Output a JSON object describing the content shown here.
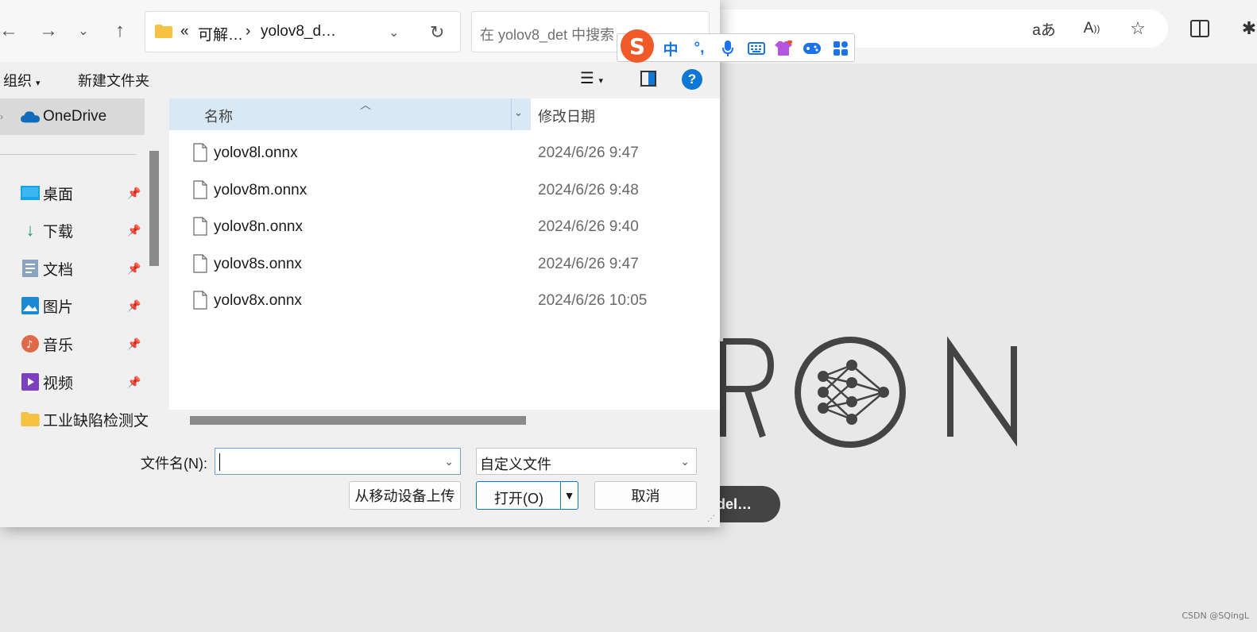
{
  "browser": {
    "open_model_label": "del…",
    "toolbar_icons": [
      "translate-icon",
      "read-aloud-icon",
      "favorite-star-icon",
      "split-screen-icon",
      "extensions-icon"
    ]
  },
  "watermark": "CSDN @SQingL",
  "dialog": {
    "breadcrumb": {
      "overflow": "«",
      "segment1": "可解…",
      "separator": "›",
      "segment2": "yolov8_d…"
    },
    "search_placeholder": "在 yolov8_det 中搜索",
    "toolbar": {
      "organize": "组织",
      "new_folder": "新建文件夹",
      "help": "?"
    },
    "sidebar": {
      "onedrive": "OneDrive",
      "items": [
        {
          "label": "桌面",
          "icon": "desktop-icon"
        },
        {
          "label": "下载",
          "icon": "download-icon"
        },
        {
          "label": "文档",
          "icon": "documents-icon"
        },
        {
          "label": "图片",
          "icon": "pictures-icon"
        },
        {
          "label": "音乐",
          "icon": "music-icon"
        },
        {
          "label": "视频",
          "icon": "videos-icon"
        },
        {
          "label": "工业缺陷检测文",
          "icon": "folder-icon"
        }
      ]
    },
    "columns": {
      "name": "名称",
      "date": "修改日期"
    },
    "files": [
      {
        "name": "yolov8l.onnx",
        "date": "2024/6/26 9:47"
      },
      {
        "name": "yolov8m.onnx",
        "date": "2024/6/26 9:48"
      },
      {
        "name": "yolov8n.onnx",
        "date": "2024/6/26 9:40"
      },
      {
        "name": "yolov8s.onnx",
        "date": "2024/6/26 9:47"
      },
      {
        "name": "yolov8x.onnx",
        "date": "2024/6/26 10:05"
      }
    ],
    "filename_label": "文件名(N):",
    "filename_value": "",
    "filter_value": "自定义文件",
    "buttons": {
      "upload": "从移动设备上传",
      "open": "打开(O)",
      "cancel": "取消"
    }
  },
  "ime": {
    "logo": "S",
    "mode": "中",
    "punct": "°,"
  }
}
